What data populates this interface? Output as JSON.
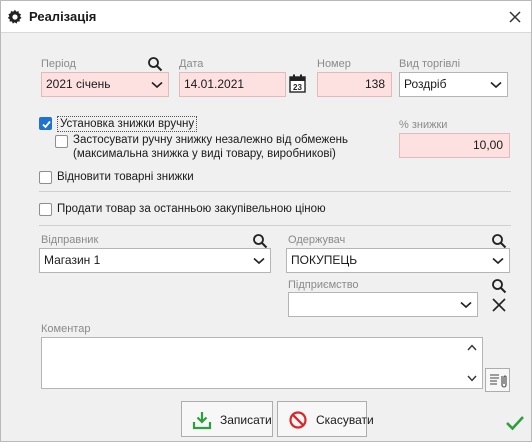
{
  "window": {
    "title": "Реалізація",
    "icon": "gear-icon",
    "close_icon": "close-icon"
  },
  "period": {
    "label": "Період",
    "value": "2021 січень"
  },
  "date": {
    "label": "Дата",
    "value": "14.01.2021",
    "calendar_day": "23"
  },
  "number": {
    "label": "Номер",
    "value": "138"
  },
  "trade_type": {
    "label": "Вид торгівлі",
    "value": "Роздріб"
  },
  "manual_discount": {
    "label": "Установка знижки вручну",
    "checked": true
  },
  "apply_discount": {
    "line1": "Застосувати ручну знижку незалежно від обмежень",
    "line2": "(максимальна знижка у виді товару, виробникові)",
    "checked": false
  },
  "discount_percent": {
    "label": "% знижки",
    "value": "10,00"
  },
  "restore_discounts": {
    "label": "Відновити товарні знижки",
    "checked": false
  },
  "sell_last_price": {
    "label": "Продати товар за останньою закупівельною ціною",
    "checked": false
  },
  "sender": {
    "label": "Відправник",
    "value": "Магазин 1"
  },
  "recipient": {
    "label": "Одержувач",
    "value": "ПОКУПЕЦЬ"
  },
  "enterprise": {
    "label": "Підприємство",
    "value": ""
  },
  "comment": {
    "label": "Коментар",
    "value": ""
  },
  "buttons": {
    "save": "Записати",
    "cancel": "Скасувати"
  },
  "colors": {
    "required_bg": "#fde1e1",
    "checkbox_checked": "#1f73cf",
    "save_icon": "#2e9e3f",
    "cancel_icon": "#d9262b",
    "status_check": "#2e9e3f"
  }
}
